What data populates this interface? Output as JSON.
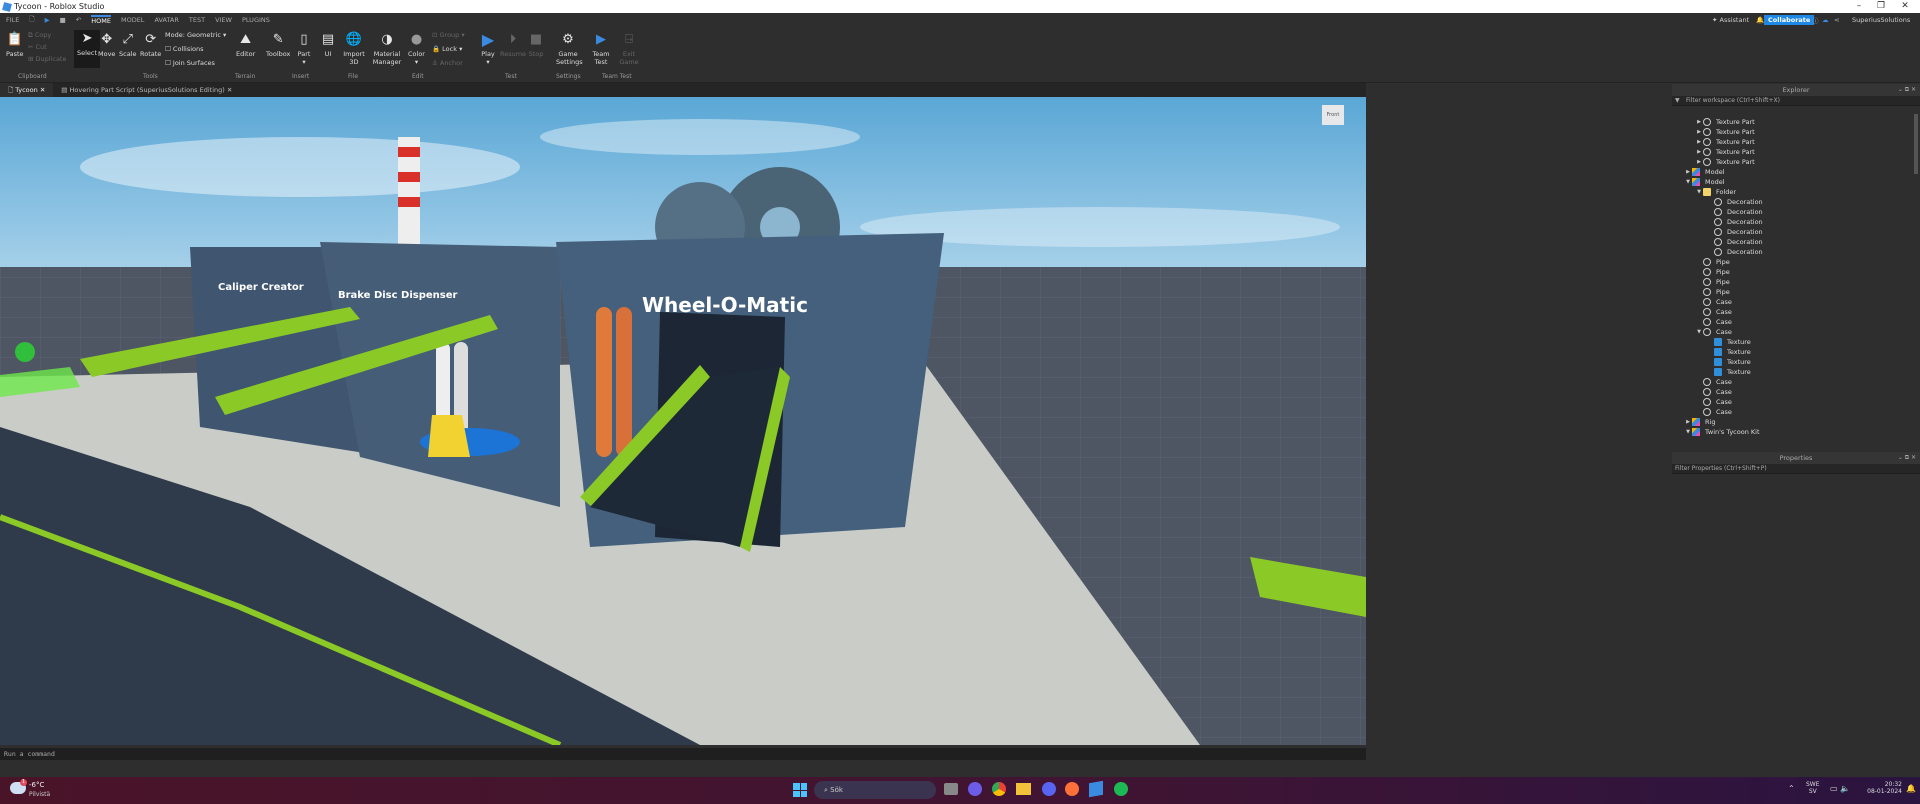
{
  "window": {
    "title": "Tycoon - Roblox Studio",
    "minimize": "–",
    "maximize": "❐",
    "close": "✕"
  },
  "menu": {
    "file": "FILE",
    "tabs": [
      "HOME",
      "MODEL",
      "AVATAR",
      "TEST",
      "VIEW",
      "PLUGINS"
    ],
    "assistant": "Assistant",
    "collaborate": "Collaborate",
    "user": "SuperiusSolutions"
  },
  "ribbon": {
    "paste": "Paste",
    "copy": "Copy",
    "cut": "Cut",
    "duplicate": "Duplicate",
    "clipboard": "Clipboard",
    "select": "Select",
    "move": "Move",
    "scale": "Scale",
    "rotate": "Rotate",
    "mode_label": "Mode:",
    "mode_value": "Geometric",
    "collisions": "Collisions",
    "join_surfaces": "Join Surfaces",
    "tools": "Tools",
    "editor": "Editor",
    "terrain": "Terrain",
    "toolbox": "Toolbox",
    "part": "Part",
    "ui": "UI",
    "insert": "Insert",
    "import3d": "Import 3D",
    "file": "File",
    "material_manager": "Material Manager",
    "color": "Color",
    "group": "Group",
    "lock": "Lock",
    "anchor": "Anchor",
    "edit": "Edit",
    "play": "Play",
    "resume": "Resume",
    "stop": "Stop",
    "test": "Test",
    "game_settings": "Game Settings",
    "settings": "Settings",
    "team_test": "Team Test",
    "exit_game": "Exit Game",
    "team_test_group": "Team Test"
  },
  "doc_tabs": [
    {
      "label": "Tycoon"
    },
    {
      "label": "Hovering Part Script (SuperiusSolutions Editing)"
    }
  ],
  "scene": {
    "labels": [
      "Caliper Creator",
      "Brake Disc Dispenser",
      "Wheel-O-Matic"
    ],
    "viewcube": "Front"
  },
  "command_bar": {
    "placeholder": "Run a command"
  },
  "explorer": {
    "title": "Explorer",
    "filter": "Filter workspace (Ctrl+Shift+X)",
    "items": [
      {
        "label": "Texture Part",
        "depth": 3,
        "icon": "part",
        "arrow": "▶"
      },
      {
        "label": "Texture Part",
        "depth": 3,
        "icon": "part",
        "arrow": "▶"
      },
      {
        "label": "Texture Part",
        "depth": 3,
        "icon": "part",
        "arrow": "▶"
      },
      {
        "label": "Texture Part",
        "depth": 3,
        "icon": "part",
        "arrow": "▶"
      },
      {
        "label": "Texture Part",
        "depth": 3,
        "icon": "part",
        "arrow": "▶"
      },
      {
        "label": "Model",
        "depth": 2,
        "icon": "model",
        "arrow": "▶"
      },
      {
        "label": "Model",
        "depth": 2,
        "icon": "model",
        "arrow": "▼"
      },
      {
        "label": "Folder",
        "depth": 3,
        "icon": "folder",
        "arrow": "▼"
      },
      {
        "label": "Decoration",
        "depth": 4,
        "icon": "part",
        "arrow": ""
      },
      {
        "label": "Decoration",
        "depth": 4,
        "icon": "part",
        "arrow": ""
      },
      {
        "label": "Decoration",
        "depth": 4,
        "icon": "part",
        "arrow": ""
      },
      {
        "label": "Decoration",
        "depth": 4,
        "icon": "part",
        "arrow": ""
      },
      {
        "label": "Decoration",
        "depth": 4,
        "icon": "part",
        "arrow": ""
      },
      {
        "label": "Decoration",
        "depth": 4,
        "icon": "part",
        "arrow": ""
      },
      {
        "label": "Pipe",
        "depth": 3,
        "icon": "part",
        "arrow": ""
      },
      {
        "label": "Pipe",
        "depth": 3,
        "icon": "part",
        "arrow": ""
      },
      {
        "label": "Pipe",
        "depth": 3,
        "icon": "part",
        "arrow": ""
      },
      {
        "label": "Pipe",
        "depth": 3,
        "icon": "part",
        "arrow": ""
      },
      {
        "label": "Case",
        "depth": 3,
        "icon": "part",
        "arrow": ""
      },
      {
        "label": "Case",
        "depth": 3,
        "icon": "part",
        "arrow": ""
      },
      {
        "label": "Case",
        "depth": 3,
        "icon": "part",
        "arrow": ""
      },
      {
        "label": "Case",
        "depth": 3,
        "icon": "part",
        "arrow": "▼"
      },
      {
        "label": "Texture",
        "depth": 4,
        "icon": "tex",
        "arrow": ""
      },
      {
        "label": "Texture",
        "depth": 4,
        "icon": "tex",
        "arrow": ""
      },
      {
        "label": "Texture",
        "depth": 4,
        "icon": "tex",
        "arrow": ""
      },
      {
        "label": "Texture",
        "depth": 4,
        "icon": "tex",
        "arrow": ""
      },
      {
        "label": "Case",
        "depth": 3,
        "icon": "part",
        "arrow": ""
      },
      {
        "label": "Case",
        "depth": 3,
        "icon": "part",
        "arrow": ""
      },
      {
        "label": "Case",
        "depth": 3,
        "icon": "part",
        "arrow": ""
      },
      {
        "label": "Case",
        "depth": 3,
        "icon": "part",
        "arrow": ""
      },
      {
        "label": "Rig",
        "depth": 2,
        "icon": "model",
        "arrow": "▶"
      },
      {
        "label": "Twin's Tycoon Kit",
        "depth": 2,
        "icon": "model",
        "arrow": "▼"
      }
    ]
  },
  "properties": {
    "title": "Properties",
    "filter": "Filter Properties (Ctrl+Shift+P)"
  },
  "taskbar": {
    "temp": "-6°C",
    "weather": "Pilvistä",
    "search": "Sök",
    "lang1": "SWE",
    "lang2": "SV",
    "time": "20:32",
    "date": "08-01-2024",
    "weather_badge": "1"
  },
  "colors": {
    "accent": "#3a8be0",
    "belt": "#8ac926",
    "building": "#3f5570"
  }
}
